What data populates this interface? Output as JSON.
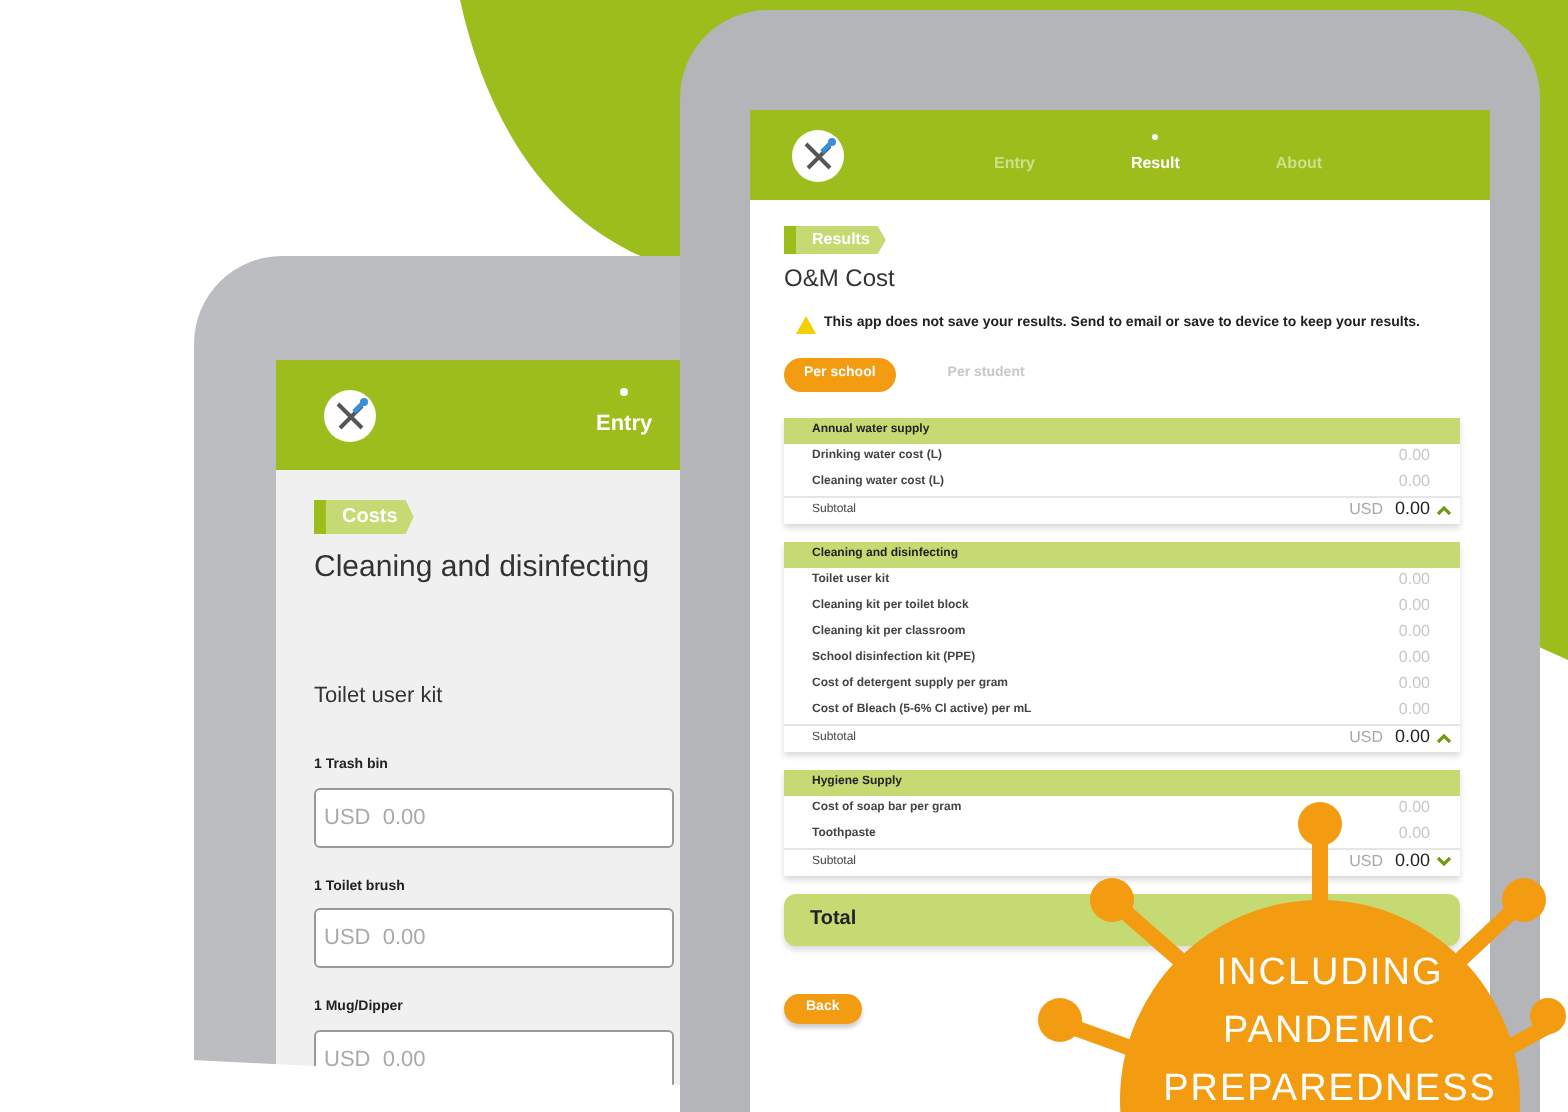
{
  "back_tablet": {
    "nav": [
      {
        "label": "Entry",
        "selected": true
      }
    ],
    "tag": "Costs",
    "title": "Cleaning and disinfecting",
    "section": "Toilet user kit",
    "fields": [
      {
        "label": "1 Trash bin",
        "placeholder": "USD  0.00"
      },
      {
        "label": "1 Toilet brush",
        "placeholder": "USD  0.00"
      },
      {
        "label": "1 Mug/Dipper",
        "placeholder": "USD  0.00"
      }
    ]
  },
  "front_tablet": {
    "nav": [
      {
        "label": "Entry",
        "selected": false
      },
      {
        "label": "Result",
        "selected": true
      },
      {
        "label": "About",
        "selected": false
      }
    ],
    "tag": "Results",
    "title": "O&M Cost",
    "warning": "This app does not save your results. Send to email or save to device to keep your results.",
    "toggle": [
      {
        "label": "Per school",
        "selected": true
      },
      {
        "label": "Per student",
        "selected": false
      }
    ],
    "groups": [
      {
        "title": "Annual water supply",
        "expanded": true,
        "rows": [
          {
            "label": "Drinking water cost (L)",
            "value": "0.00"
          },
          {
            "label": "Cleaning water cost (L)",
            "value": "0.00"
          }
        ],
        "subtotal": {
          "label": "Subtotal",
          "currency": "USD",
          "value": "0.00"
        }
      },
      {
        "title": "Cleaning and disinfecting",
        "expanded": true,
        "rows": [
          {
            "label": "Toilet user kit",
            "value": "0.00"
          },
          {
            "label": "Cleaning kit per toilet block",
            "value": "0.00"
          },
          {
            "label": "Cleaning kit per classroom",
            "value": "0.00"
          },
          {
            "label": "School disinfection kit (PPE)",
            "value": "0.00"
          },
          {
            "label": "Cost of detergent supply per gram",
            "value": "0.00"
          },
          {
            "label": "Cost of Bleach (5-6% Cl active) per mL",
            "value": "0.00"
          }
        ],
        "subtotal": {
          "label": "Subtotal",
          "currency": "USD",
          "value": "0.00"
        }
      },
      {
        "title": "Hygiene Supply",
        "expanded": false,
        "rows": [
          {
            "label": "Cost of soap bar per gram",
            "value": "0.00"
          },
          {
            "label": "Toothpaste",
            "value": "0.00"
          }
        ],
        "subtotal": {
          "label": "Subtotal",
          "currency": "USD",
          "value": "0.00"
        }
      }
    ],
    "total": "Total",
    "back_button": "Back"
  },
  "badge": "INCLUDING PANDEMIC PREPAREDNESS"
}
